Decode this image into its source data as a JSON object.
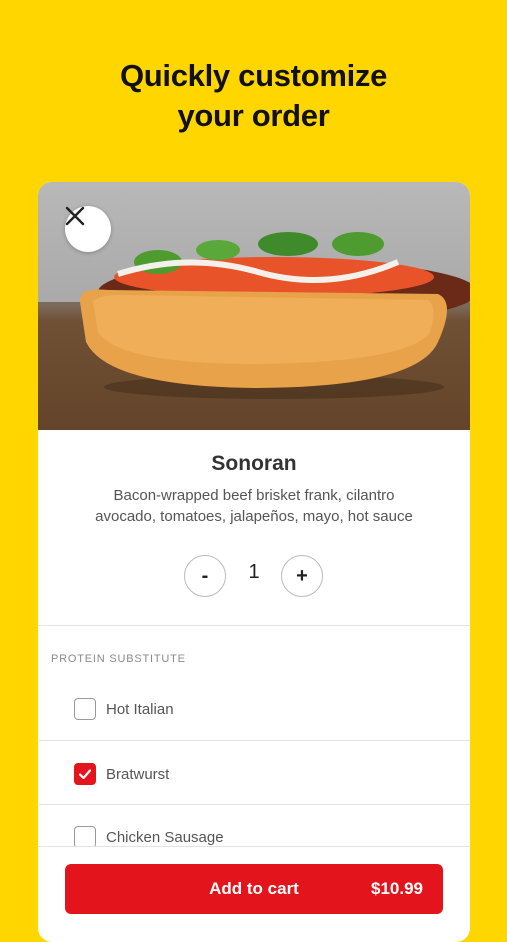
{
  "headline": {
    "line1": "Quickly customize",
    "line2": "your order"
  },
  "item": {
    "name": "Sonoran",
    "description_line1": "Bacon-wrapped beef brisket frank, cilantro",
    "description_line2": "avocado, tomatoes, jalapeños, mayo, hot sauce",
    "image_icon": "hot-dog-photo"
  },
  "quantity": {
    "minus_label": "-",
    "value": "1",
    "plus_label": "+"
  },
  "options": {
    "section_title": "PROTEIN SUBSTITUTE",
    "items": [
      {
        "label": "Hot Italian",
        "checked": false
      },
      {
        "label": "Bratwurst",
        "checked": true
      },
      {
        "label": "Chicken Sausage",
        "checked": false
      }
    ]
  },
  "cart": {
    "add_label": "Add to cart",
    "price": "$10.99"
  },
  "colors": {
    "background": "#FFD600",
    "accent": "#E3141B"
  },
  "icons": {
    "close": "close-icon",
    "check": "checkmark-icon"
  }
}
